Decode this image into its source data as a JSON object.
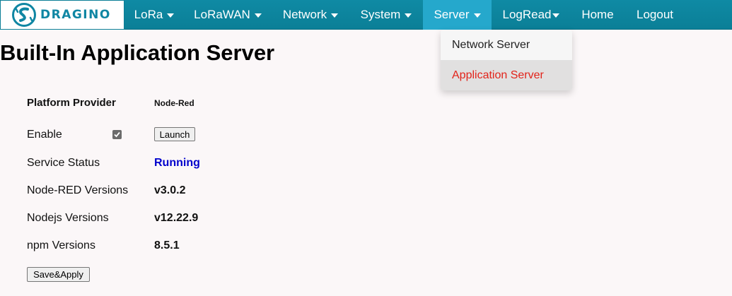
{
  "brand": {
    "name": "DRAGINO",
    "logo_icon": "dragino-logo-icon"
  },
  "nav": {
    "items": [
      {
        "label": "LoRa",
        "caret": true
      },
      {
        "label": "LoRaWAN",
        "caret": true
      },
      {
        "label": "Network",
        "caret": true
      },
      {
        "label": "System",
        "caret": true
      },
      {
        "label": "Server",
        "caret": true,
        "active": true
      },
      {
        "label": "LogRead",
        "caret": true
      },
      {
        "label": "Home",
        "caret": false
      },
      {
        "label": "Logout",
        "caret": false
      }
    ]
  },
  "server_menu": {
    "items": [
      {
        "label": "Network Server"
      },
      {
        "label": "Application Server",
        "selected": true
      }
    ]
  },
  "page": {
    "title": "Built-In Application Server"
  },
  "form": {
    "platform_provider_label": "Platform Provider",
    "platform_provider_value": "Node-Red",
    "enable_label": "Enable",
    "enable_checked": true,
    "launch_button": "Launch",
    "service_status_label": "Service Status",
    "service_status_value": "Running",
    "service_status_color": "#0000cc",
    "nodered_label": "Node-RED Versions",
    "nodered_value": "v3.0.2",
    "nodejs_label": "Nodejs Versions",
    "nodejs_value": "v12.22.9",
    "npm_label": "npm Versions",
    "npm_value": "8.5.1",
    "save_button": "Save&Apply"
  },
  "colors": {
    "navbar": "#0b7f97",
    "nav_active": "#25a8cc",
    "selected_menu_text": "#e2231a"
  }
}
